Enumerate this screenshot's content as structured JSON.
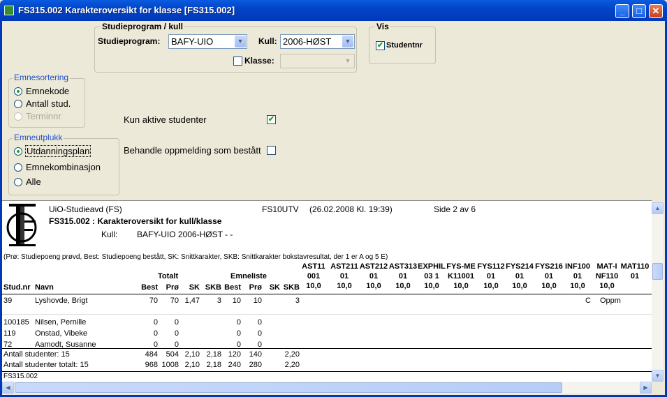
{
  "window": {
    "title": "FS315.002 Karakteroversikt for klasse [FS315.002]"
  },
  "studieprogram_group": {
    "title": "Studieprogram / kull",
    "program_label": "Studieprogram:",
    "program_value": "BAFY-UIO",
    "kull_label": "Kull:",
    "kull_value": "2006-HØST",
    "klasse_label": "Klasse:",
    "klasse_checked": false
  },
  "vis_group": {
    "title": "Vis",
    "studentnr_label": "Studentnr",
    "studentnr_checked": true
  },
  "emnesortering": {
    "title": "Emnesortering",
    "options": [
      {
        "label": "Emnekode",
        "selected": true,
        "disabled": false
      },
      {
        "label": "Antall stud.",
        "selected": false,
        "disabled": false
      },
      {
        "label": "Terminnr",
        "selected": false,
        "disabled": true
      }
    ]
  },
  "emneutplukk": {
    "title": "Emneutplukk",
    "options": [
      {
        "label": "Utdanningsplan",
        "selected": true
      },
      {
        "label": "Emnekombinasjon",
        "selected": false
      },
      {
        "label": "Alle",
        "selected": false
      }
    ]
  },
  "kun_aktive": {
    "label": "Kun aktive studenter",
    "checked": true
  },
  "behandle": {
    "label": "Behandle oppmelding som bestått",
    "checked": false
  },
  "report": {
    "org": "UiO-Studieavd (FS)",
    "code": "FS10UTV",
    "timestamp": "(26.02.2008 Kl. 19:39)",
    "page": "Side 2 av 6",
    "title": "FS315.002 : Karakteroversikt for kull/klasse",
    "kull_label": "Kull:",
    "kull_value": "BAFY-UIO 2006-HØST - -",
    "legend": "(Prø: Studiepoeng prøvd, Best: Studiepoeng bestått, SK: Snittkarakter, SKB: Snittkarakter bokstavresultat, der 1 er A og 5 E)",
    "group_totalt": "Totalt",
    "group_emneliste": "Emneliste",
    "col_studnr": "Stud.nr",
    "col_navn": "Navn",
    "cols": [
      "Best",
      "Prø",
      "SK",
      "SKB",
      "Best",
      "Prø",
      "SK",
      "SKB"
    ],
    "courses": [
      {
        "code": "AST11",
        "ver": "001",
        "sp": "10,0"
      },
      {
        "code": "AST211",
        "ver": "01",
        "sp": "10,0"
      },
      {
        "code": "AST212",
        "ver": "01",
        "sp": "10,0"
      },
      {
        "code": "AST313",
        "ver": "01",
        "sp": "10,0"
      },
      {
        "code": "EXPHIL",
        "ver": "03 1",
        "sp": "10,0"
      },
      {
        "code": "FYS-ME",
        "ver": "K11001",
        "sp": "10,0"
      },
      {
        "code": "FYS112",
        "ver": "01",
        "sp": "10,0"
      },
      {
        "code": "FYS214",
        "ver": "01",
        "sp": "10,0"
      },
      {
        "code": "FYS216",
        "ver": "01",
        "sp": "10,0"
      },
      {
        "code": "INF100",
        "ver": "01",
        "sp": "10,0"
      },
      {
        "code": "MAT-I",
        "ver": "NF110",
        "sp": "10,0"
      },
      {
        "code": "MAT110",
        "ver": "01",
        "sp": ""
      }
    ],
    "rows": [
      {
        "studnr": "39",
        "navn": "Lyshovde, Brigt",
        "v": [
          "70",
          "70",
          "1,47",
          "3",
          "10",
          "10",
          "",
          "3"
        ],
        "extra1": "C",
        "extra2": "Oppm"
      },
      {
        "studnr": "100185",
        "navn": "Nilsen, Pernille",
        "v": [
          "0",
          "0",
          "",
          "",
          "0",
          "0",
          "",
          ""
        ]
      },
      {
        "studnr": "119",
        "navn": "Onstad, Vibeke",
        "v": [
          "0",
          "0",
          "",
          "",
          "0",
          "0",
          "",
          ""
        ]
      },
      {
        "studnr": "72",
        "navn": "Aamodt, Susanne",
        "v": [
          "0",
          "0",
          "",
          "",
          "0",
          "0",
          "",
          ""
        ]
      }
    ],
    "totals": [
      {
        "label": "Antall studenter: 15",
        "v": [
          "484",
          "504",
          "2,10",
          "2,18",
          "120",
          "140",
          "",
          "2,20"
        ]
      },
      {
        "label": "Antall studenter totalt: 15",
        "v": [
          "968",
          "1008",
          "2,10",
          "2,18",
          "240",
          "280",
          "",
          "2,20"
        ]
      }
    ],
    "footer": "FS315.002"
  }
}
